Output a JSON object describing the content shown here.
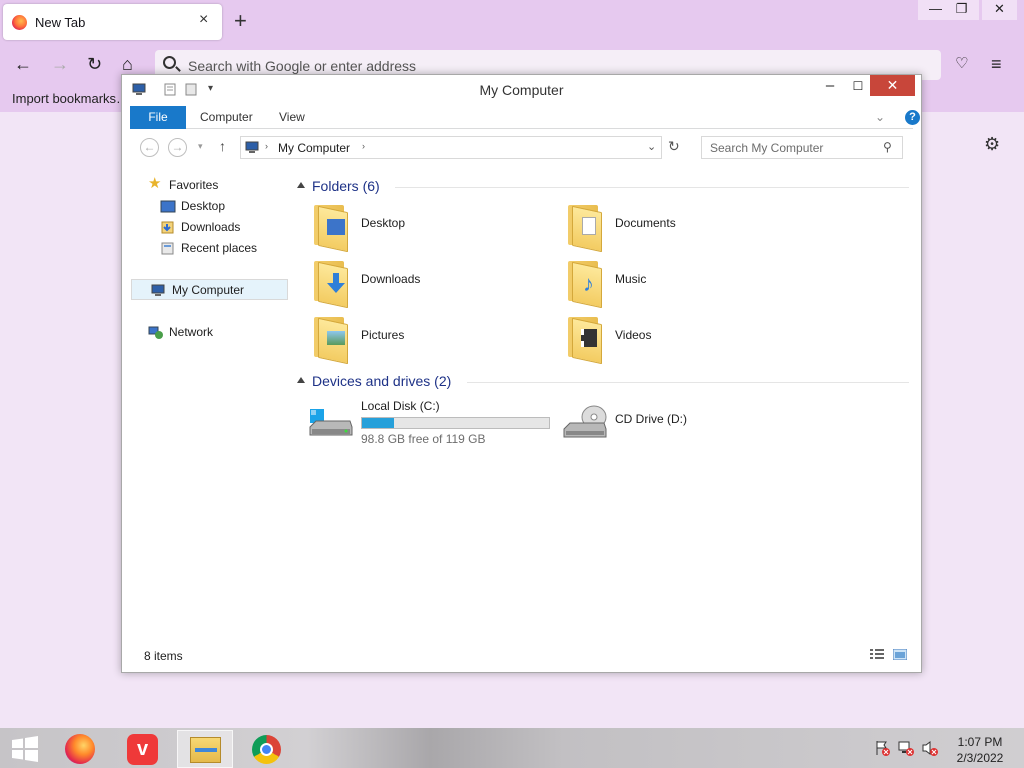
{
  "browser": {
    "tab_title": "New Tab",
    "tab_close": "×",
    "new_tab": "+",
    "url_placeholder": "Search with Google or enter address",
    "import_bookmarks": "Import bookmarks…",
    "win_min": "—",
    "win_restore": "❐",
    "win_close": "✕"
  },
  "explorer": {
    "title": "My Computer",
    "ribbon_tabs": [
      "File",
      "Computer",
      "View"
    ],
    "address": "My Computer",
    "search_placeholder": "Search My Computer",
    "tree": {
      "favorites": "Favorites",
      "desktop": "Desktop",
      "downloads": "Downloads",
      "recent": "Recent places",
      "my_computer": "My Computer",
      "network": "Network"
    },
    "folders_header": "Folders (6)",
    "folders": [
      "Desktop",
      "Documents",
      "Downloads",
      "Music",
      "Pictures",
      "Videos"
    ],
    "devices_header": "Devices and drives (2)",
    "drive_c": {
      "label": "Local Disk (C:)",
      "free": "98.8 GB free of 119 GB",
      "used_fraction": 0.17
    },
    "drive_d": {
      "label": "CD Drive (D:)"
    },
    "status": "8 items"
  },
  "taskbar": {
    "clock_time": "1:07 PM",
    "clock_date": "2/3/2022"
  },
  "colors": {
    "accent": "#1979ca",
    "chrome": "#e6c9ef",
    "close_red": "#c8463a"
  }
}
